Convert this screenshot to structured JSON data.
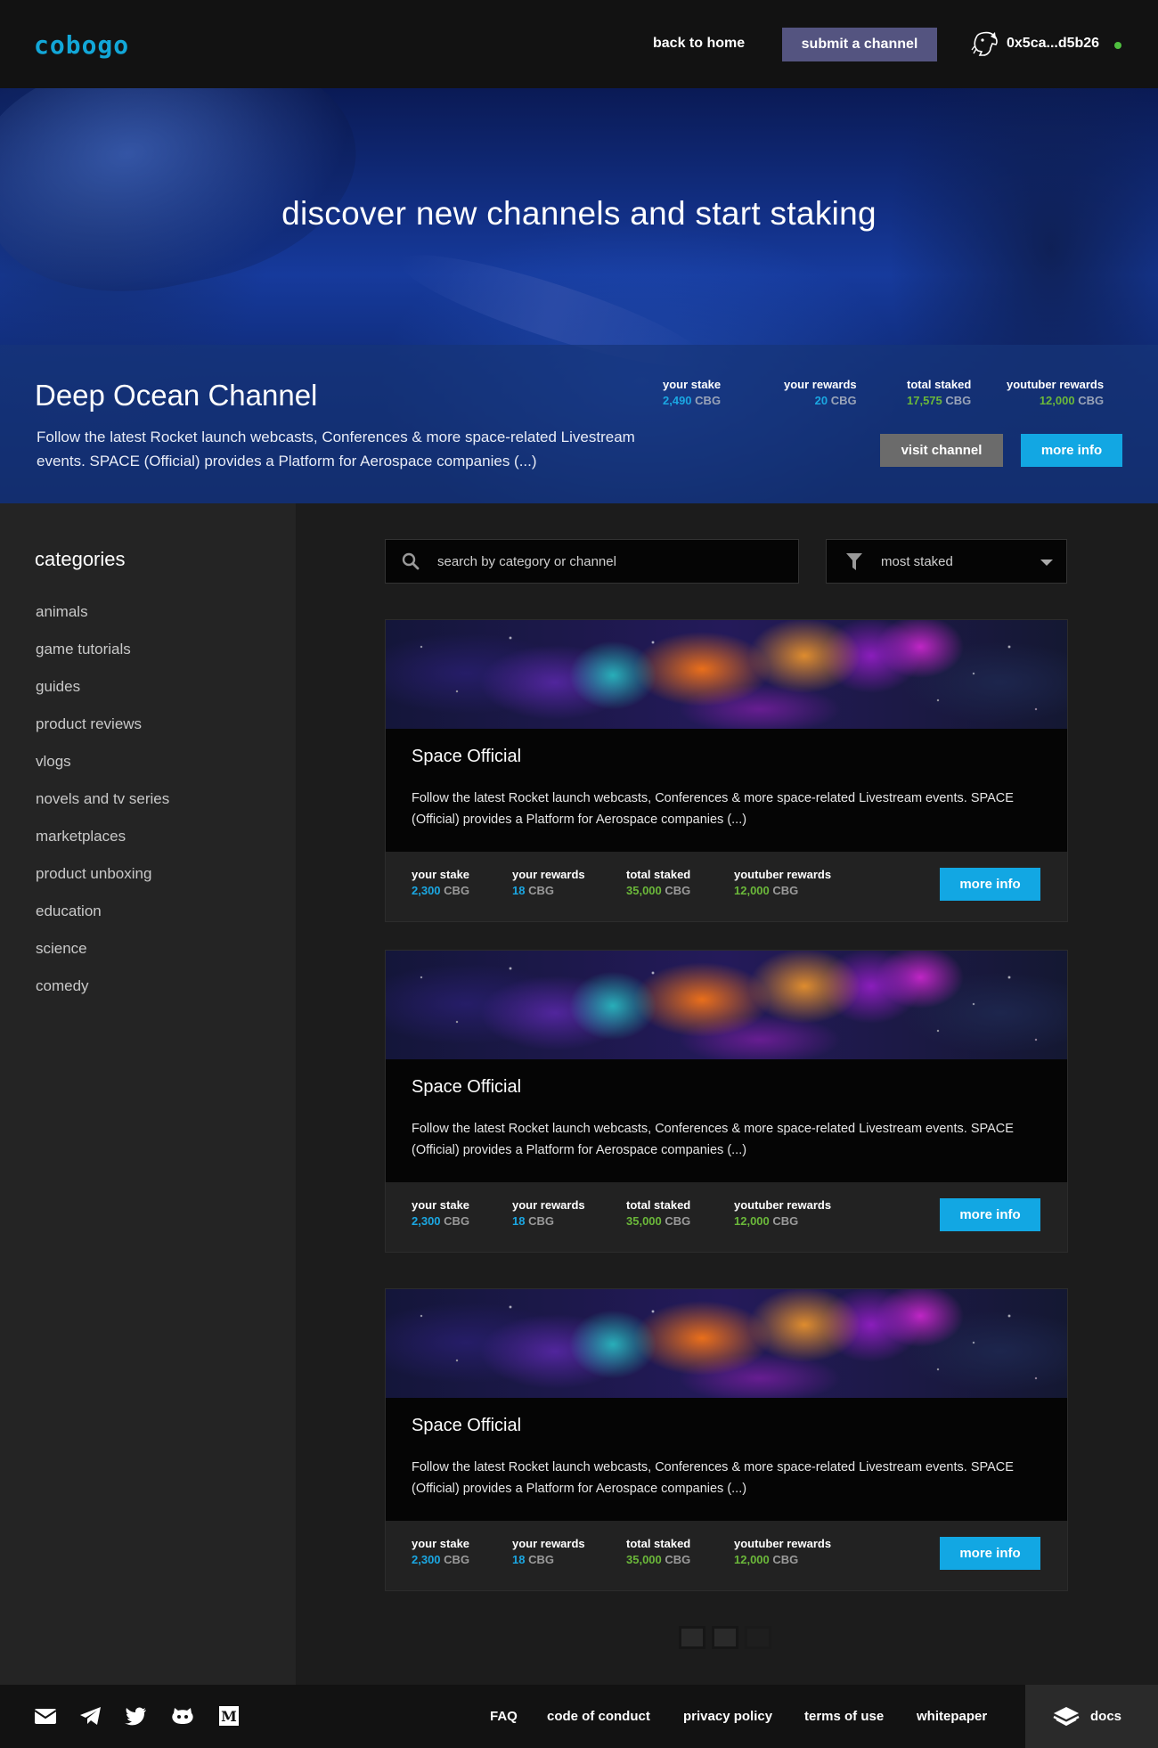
{
  "header": {
    "logo": "cobogo",
    "back_home": "back to home",
    "submit_channel": "submit a channel",
    "wallet_address": "0x5ca...d5b26"
  },
  "hero": {
    "title": "discover new channels and start staking",
    "featured": {
      "name": "Deep Ocean Channel",
      "description": "Follow the latest Rocket launch webcasts, Conferences & more space-related Livestream events. SPACE (Official) provides a Platform for Aerospace companies (...)",
      "stats": [
        {
          "label": "your stake",
          "value": "2,490",
          "unit": "CBG",
          "color": "#1ba7e2"
        },
        {
          "label": "your rewards",
          "value": "20",
          "unit": "CBG",
          "color": "#1ba7e2"
        },
        {
          "label": "total staked",
          "value": "17,575",
          "unit": "CBG",
          "color": "#6bb83a"
        },
        {
          "label": "youtuber rewards",
          "value": "12,000",
          "unit": "CBG",
          "color": "#6bb83a"
        }
      ],
      "visit_label": "visit channel",
      "more_label": "more info"
    }
  },
  "sidebar": {
    "title": "categories",
    "items": [
      "animals",
      "game tutorials",
      "guides",
      "product reviews",
      "vlogs",
      "novels and tv series",
      "marketplaces",
      "product unboxing",
      "education",
      "science",
      "comedy"
    ]
  },
  "search": {
    "placeholder": "search by category or channel",
    "icon": "search-icon"
  },
  "sort": {
    "selected": "most staked",
    "icon": "filter-icon"
  },
  "cards": [
    {
      "title": "Space Official",
      "description": "Follow the latest Rocket launch webcasts, Conferences & more space-related Livestream events. SPACE (Official) provides a Platform for Aerospace companies (...)",
      "stats": [
        {
          "label": "your stake",
          "value": "2,300",
          "unit": "CBG"
        },
        {
          "label": "your rewards",
          "value": "18",
          "unit": "CBG"
        },
        {
          "label": "total staked",
          "value": "35,000",
          "unit": "CBG"
        },
        {
          "label": "youtuber rewards",
          "value": "12,000",
          "unit": "CBG"
        }
      ],
      "button": "more info"
    },
    {
      "title": "Space Official",
      "description": "Follow the latest Rocket launch webcasts, Conferences & more space-related Livestream events. SPACE (Official) provides a Platform for Aerospace companies (...)",
      "stats": [
        {
          "label": "your stake",
          "value": "2,300",
          "unit": "CBG"
        },
        {
          "label": "your rewards",
          "value": "18",
          "unit": "CBG"
        },
        {
          "label": "total staked",
          "value": "35,000",
          "unit": "CBG"
        },
        {
          "label": "youtuber rewards",
          "value": "12,000",
          "unit": "CBG"
        }
      ],
      "button": "more info"
    },
    {
      "title": "Space Official",
      "description": "Follow the latest Rocket launch webcasts, Conferences & more space-related Livestream events. SPACE (Official) provides a Platform for Aerospace companies (...)",
      "stats": [
        {
          "label": "your stake",
          "value": "2,300",
          "unit": "CBG"
        },
        {
          "label": "your rewards",
          "value": "18",
          "unit": "CBG"
        },
        {
          "label": "total staked",
          "value": "35,000",
          "unit": "CBG"
        },
        {
          "label": "youtuber rewards",
          "value": "12,000",
          "unit": "CBG"
        }
      ],
      "button": "more info"
    }
  ],
  "footer": {
    "social_icons": [
      "mail-icon",
      "telegram-icon",
      "twitter-icon",
      "github-icon",
      "medium-icon"
    ],
    "links": [
      "FAQ",
      "code of conduct",
      "privacy policy",
      "terms of use",
      "whitepaper"
    ],
    "docs_label": "docs"
  },
  "colors": {
    "accent": "#12a7e3",
    "brand": "#12a7d8",
    "submit_button": "#545480",
    "positive": "#6bb83a",
    "online": "#4fbf3f"
  }
}
